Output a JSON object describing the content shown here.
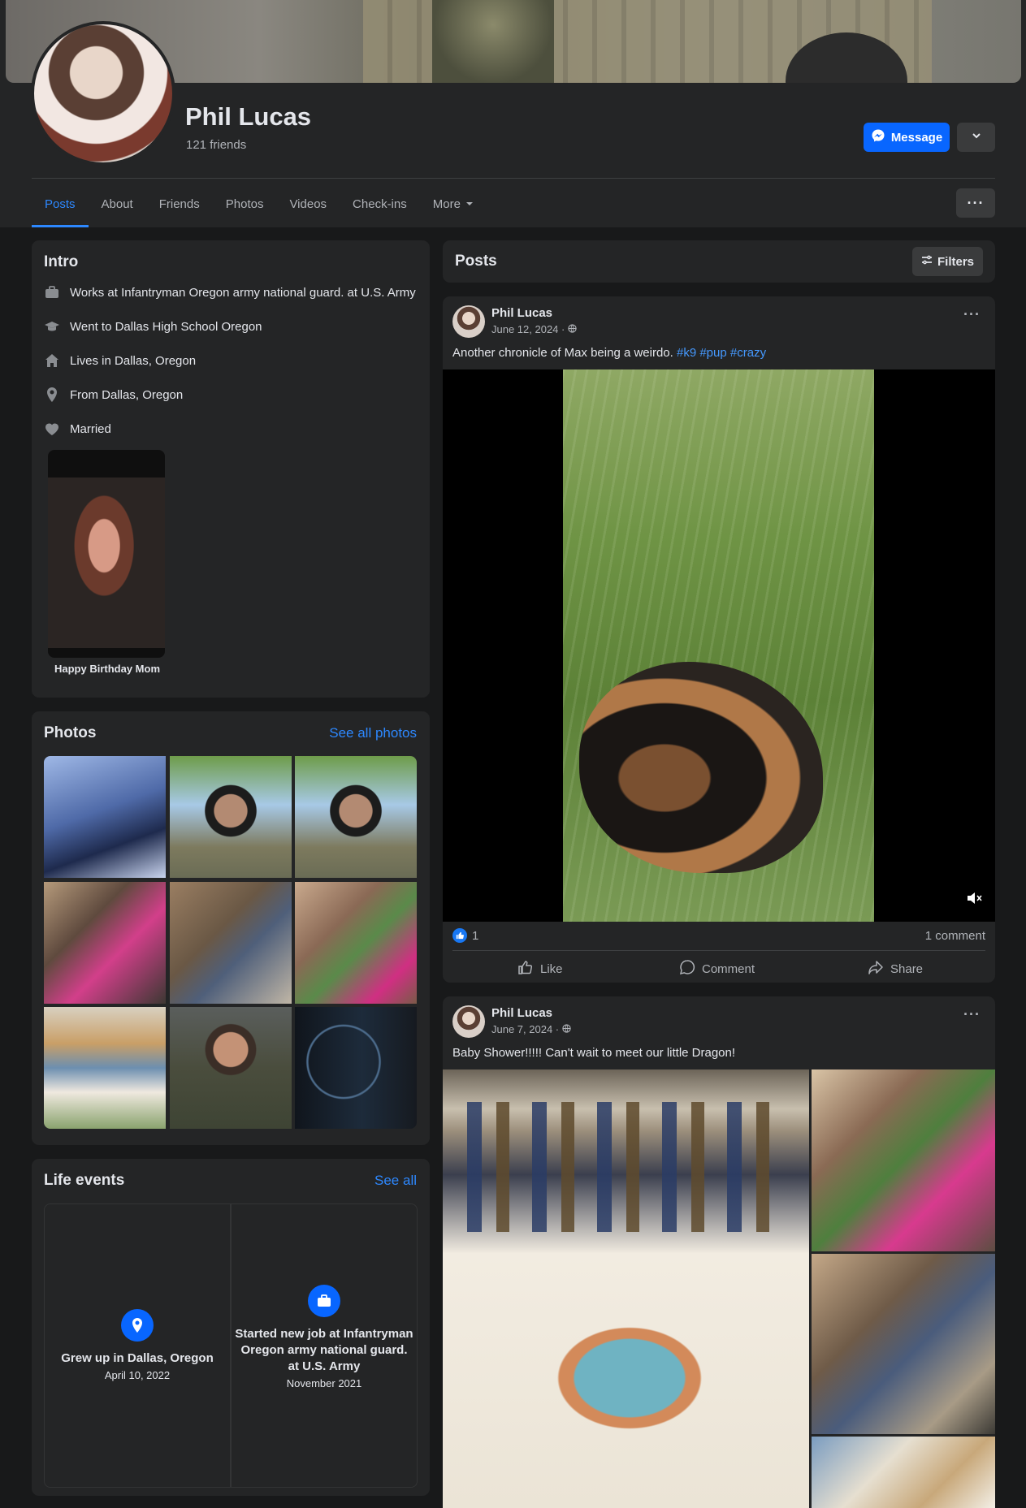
{
  "profile": {
    "name": "Phil Lucas",
    "friends": "121 friends",
    "message_label": "Message"
  },
  "tabs": [
    "Posts",
    "About",
    "Friends",
    "Photos",
    "Videos",
    "Check-ins",
    "More"
  ],
  "intro": {
    "title": "Intro",
    "work": {
      "prefix": "Works at ",
      "value": "Infantryman Oregon army national guard. at U.S. Army"
    },
    "education": {
      "prefix": "Went to ",
      "value": "Dallas High School Oregon"
    },
    "lives": {
      "prefix": "Lives in ",
      "value": "Dallas, Oregon"
    },
    "from": {
      "prefix": "From ",
      "value": "Dallas, Oregon"
    },
    "relationship": "Married",
    "featured_caption": "Happy Birthday Mom"
  },
  "photos": {
    "title": "Photos",
    "see_all": "See all photos"
  },
  "life_events": {
    "title": "Life events",
    "see_all": "See all",
    "items": [
      {
        "text": "Grew up in Dallas, Oregon",
        "date": "April 10, 2022"
      },
      {
        "text": "Started new job at Infantryman Oregon army national guard. at U.S. Army",
        "date": "November 2021"
      }
    ]
  },
  "posts_header": {
    "title": "Posts",
    "filters": "Filters"
  },
  "posts": [
    {
      "author": "Phil Lucas",
      "date": "June 12, 2024 ·",
      "text": "Another chronicle of Max being a weirdo. ",
      "tags": [
        "#k9",
        "#pup",
        "#crazy"
      ],
      "reactions": "1",
      "comments": "1 comment",
      "actions": {
        "like": "Like",
        "comment": "Comment",
        "share": "Share"
      }
    },
    {
      "author": "Phil Lucas",
      "date": "June 7, 2024 ·",
      "text": "Baby Shower!!!!! Can't wait to meet our little Dragon!"
    }
  ]
}
